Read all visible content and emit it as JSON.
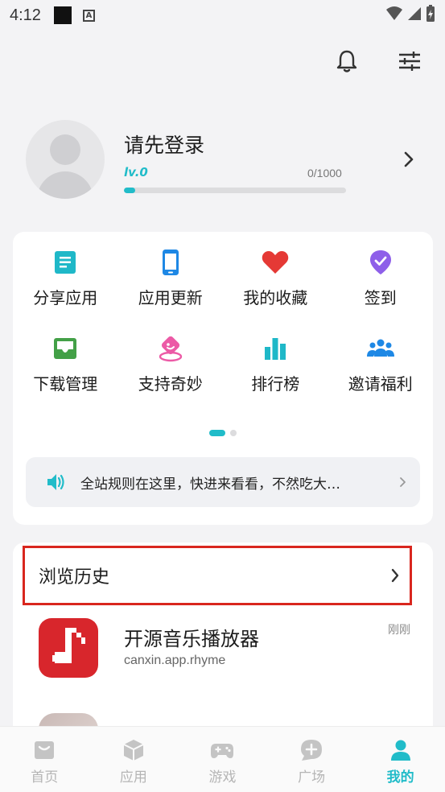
{
  "status_bar": {
    "time": "4:12"
  },
  "header": {
    "icons": [
      "bell-icon",
      "sliders-icon"
    ]
  },
  "profile": {
    "title": "请先登录",
    "level": "lv.0",
    "exp": "0/1000",
    "progress_fraction": 0.05
  },
  "menu": {
    "items": [
      {
        "label": "分享应用",
        "icon": "share-doc-icon",
        "color": "#1fb8c8"
      },
      {
        "label": "应用更新",
        "icon": "phone-icon",
        "color": "#1e88e5"
      },
      {
        "label": "我的收藏",
        "icon": "heart-icon",
        "color": "#e53935"
      },
      {
        "label": "签到",
        "icon": "badge-check-icon",
        "color": "#8e5fe9"
      },
      {
        "label": "下载管理",
        "icon": "download-tray-icon",
        "color": "#43a047"
      },
      {
        "label": "支持奇妙",
        "icon": "support-icon",
        "color": "#ec5aa6"
      },
      {
        "label": "排行榜",
        "icon": "bar-chart-icon",
        "color": "#1fb8c8"
      },
      {
        "label": "邀请福利",
        "icon": "group-icon",
        "color": "#1e88e5"
      }
    ],
    "pager": {
      "pages": 2,
      "current": 1
    }
  },
  "notice": {
    "text": "全站规则在这里，快进来看看，不然吃大…"
  },
  "history": {
    "title": "浏览历史",
    "apps": [
      {
        "name": "开源音乐播放器",
        "package": "canxin.app.rhyme",
        "time": "刚刚"
      }
    ]
  },
  "tabs": [
    {
      "label": "首页",
      "icon": "home-icon",
      "active": false
    },
    {
      "label": "应用",
      "icon": "cube-icon",
      "active": false
    },
    {
      "label": "游戏",
      "icon": "gamepad-icon",
      "active": false
    },
    {
      "label": "广场",
      "icon": "chat-plus-icon",
      "active": false
    },
    {
      "label": "我的",
      "icon": "person-icon",
      "active": true
    }
  ],
  "colors": {
    "accent": "#21bcc9",
    "highlight_border": "#d9261e"
  }
}
